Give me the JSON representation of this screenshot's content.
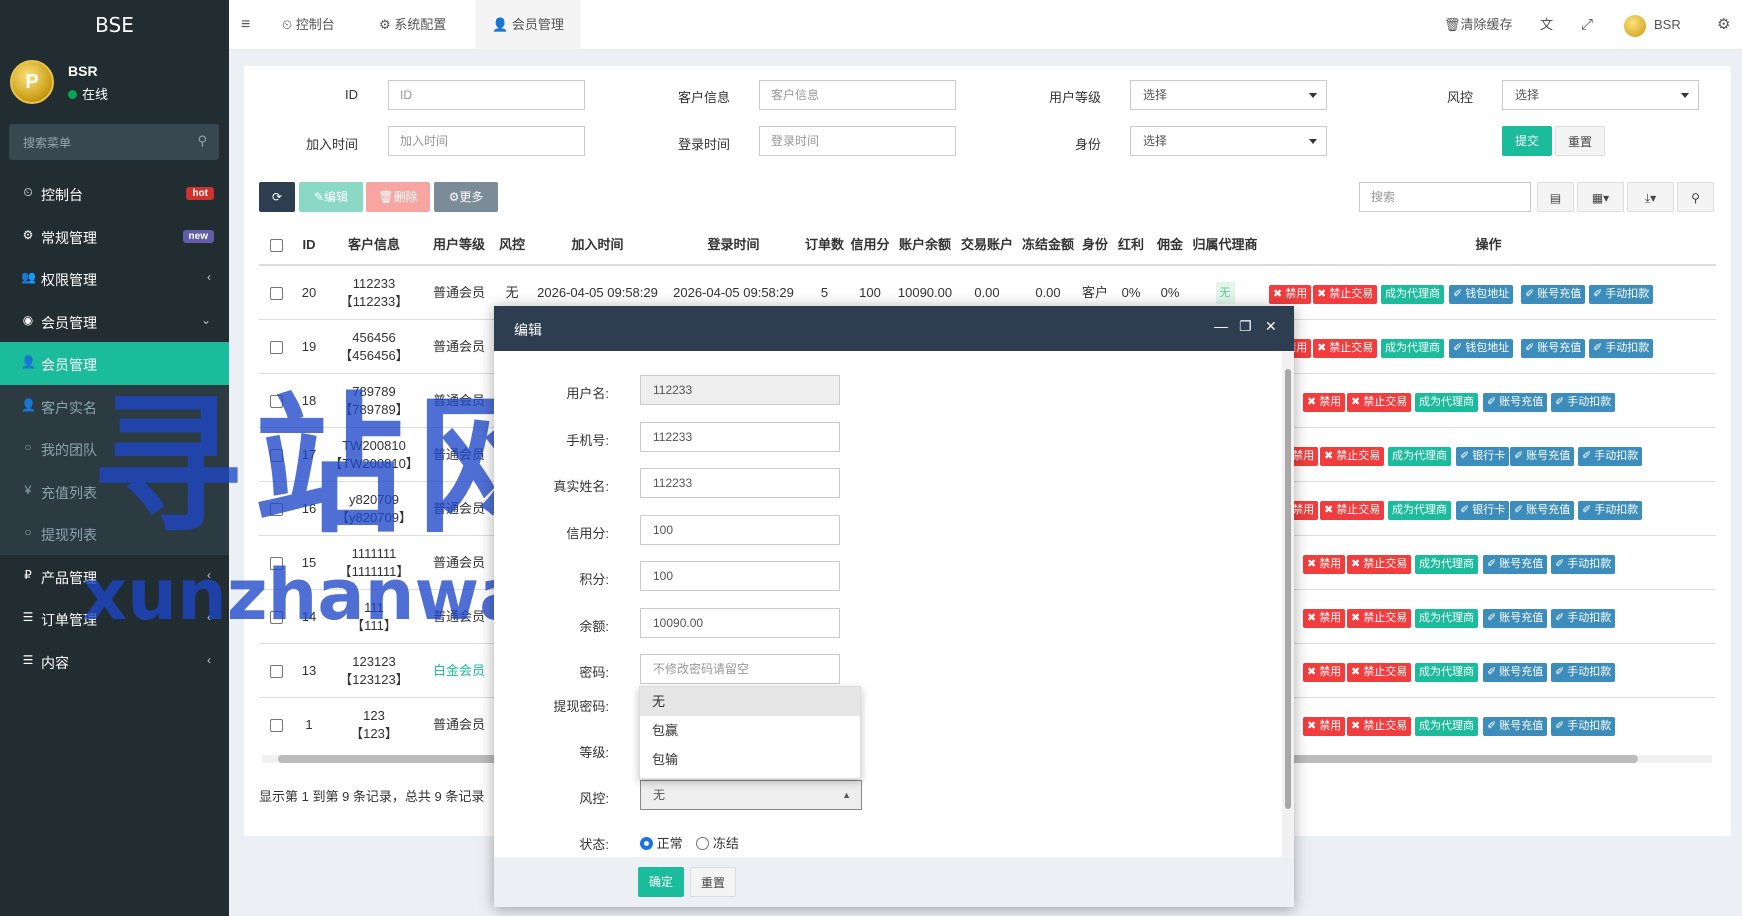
{
  "brand": "BSE",
  "user": {
    "name": "BSR",
    "status": "在线",
    "avatar_letter": "P"
  },
  "sidebar_search_placeholder": "搜索菜单",
  "menu": [
    {
      "label": "控制台",
      "icon": "dashboard-icon",
      "badge": "hot",
      "badge_color": "#d2322d"
    },
    {
      "label": "常规管理",
      "icon": "cogs-icon",
      "badge": "new",
      "badge_color": "#605ca8"
    },
    {
      "label": "权限管理",
      "icon": "users-icon",
      "arrow": "‹"
    },
    {
      "label": "会员管理",
      "icon": "user-circle-icon",
      "arrow": "⌄"
    },
    {
      "label": "会员管理",
      "icon": "user-icon",
      "active": true
    },
    {
      "label": "客户实名",
      "icon": "user-icon"
    },
    {
      "label": "我的团队",
      "icon": "circle-icon"
    },
    {
      "label": "充值列表",
      "icon": "yen-icon"
    },
    {
      "label": "提现列表",
      "icon": "circle-icon"
    },
    {
      "label": "产品管理",
      "icon": "ruble-icon",
      "arrow": "‹"
    },
    {
      "label": "订单管理",
      "icon": "list-icon",
      "arrow": "‹"
    },
    {
      "label": "内容",
      "icon": "list-icon",
      "arrow": "‹"
    }
  ],
  "topbar": {
    "tabs": [
      "控制台",
      "系统配置",
      "会员管理"
    ],
    "clear_cache": "清除缓存",
    "username": "BSR"
  },
  "filters": {
    "id_label": "ID",
    "id_placeholder": "ID",
    "customer_label": "客户信息",
    "customer_placeholder": "客户信息",
    "level_label": "用户等级",
    "level_value": "选择",
    "risk_label": "风控",
    "risk_value": "选择",
    "join_label": "加入时间",
    "join_placeholder": "加入时间",
    "login_label": "登录时间",
    "login_placeholder": "登录时间",
    "identity_label": "身份",
    "identity_value": "选择",
    "submit": "提交",
    "reset": "重置"
  },
  "toolbar": {
    "edit": "编辑",
    "delete": "删除",
    "more": "更多",
    "search_placeholder": "搜索"
  },
  "table": {
    "headers": [
      "ID",
      "客户信息",
      "用户等级",
      "风控",
      "加入时间",
      "登录时间",
      "订单数",
      "信用分",
      "账户余额",
      "交易账户",
      "冻结金额",
      "身份",
      "红利",
      "佣金",
      "归属代理商",
      "操作"
    ],
    "first_row": {
      "id": "20",
      "cust": "112233",
      "cust2": "【112233】",
      "level": "普通会员",
      "risk": "无",
      "join": "2026-04-05 09:58:29",
      "login": "2026-04-05 09:58:29",
      "orders": "5",
      "credit": "100",
      "balance": "10090.00",
      "trade": "0.00",
      "frozen": "0.00",
      "identity": "客户",
      "bonus": "0%",
      "comm": "0%",
      "agent": "无"
    },
    "rows": [
      {
        "id": "19",
        "cust": "456456",
        "cust2": "【456456】",
        "level": "普通会员"
      },
      {
        "id": "18",
        "cust": "789789",
        "cust2": "【789789】",
        "level": "普通会员"
      },
      {
        "id": "17",
        "cust": "TW200810",
        "cust2": "【TW200810】",
        "level": "普通会员"
      },
      {
        "id": "16",
        "cust": "y820709",
        "cust2": "【y820709】",
        "level": "普通会员"
      },
      {
        "id": "15",
        "cust": "1111111",
        "cust2": "【1111111】",
        "level": "普通会员"
      },
      {
        "id": "14",
        "cust": "111",
        "cust2": "【111】",
        "level": "普通会员"
      },
      {
        "id": "13",
        "cust": "123123",
        "cust2": "【123123】",
        "level": "白金会员"
      },
      {
        "id": "1",
        "cust": "123",
        "cust2": "【123】",
        "level": "普通会员"
      }
    ],
    "actions": {
      "ban": "✖ 禁用",
      "ban_trade": "✖ 禁止交易",
      "make_agent": "成为代理商",
      "wallet": "✐ 钱包地址",
      "bank": "✐ 银行卡",
      "recharge": "✐ 账号充值",
      "deduct": "✐ 手动扣款"
    },
    "footer": "显示第 1 到第 9 条记录，总共 9 条记录"
  },
  "watermark": {
    "cn": "寻站网",
    "en": "xunzhanwang.com"
  },
  "modal": {
    "title": "编辑",
    "fields": [
      {
        "label": "用户名:",
        "value": "112233",
        "readonly": true
      },
      {
        "label": "手机号:",
        "value": "112233"
      },
      {
        "label": "真实姓名:",
        "value": "112233"
      },
      {
        "label": "信用分:",
        "value": "100"
      },
      {
        "label": "积分:",
        "value": "100"
      },
      {
        "label": "余额:",
        "value": "10090.00"
      },
      {
        "label": "密码:",
        "placeholder": "不修改密码请留空"
      }
    ],
    "withdraw_label": "提现密码:",
    "level_label": "等级:",
    "risk_label": "风控:",
    "risk_value": "无",
    "dropdown_options": [
      "无",
      "包赢",
      "包输"
    ],
    "status_label": "状态:",
    "status_normal": "正常",
    "status_frozen": "冻结",
    "confirm": "确定",
    "reset": "重置"
  }
}
